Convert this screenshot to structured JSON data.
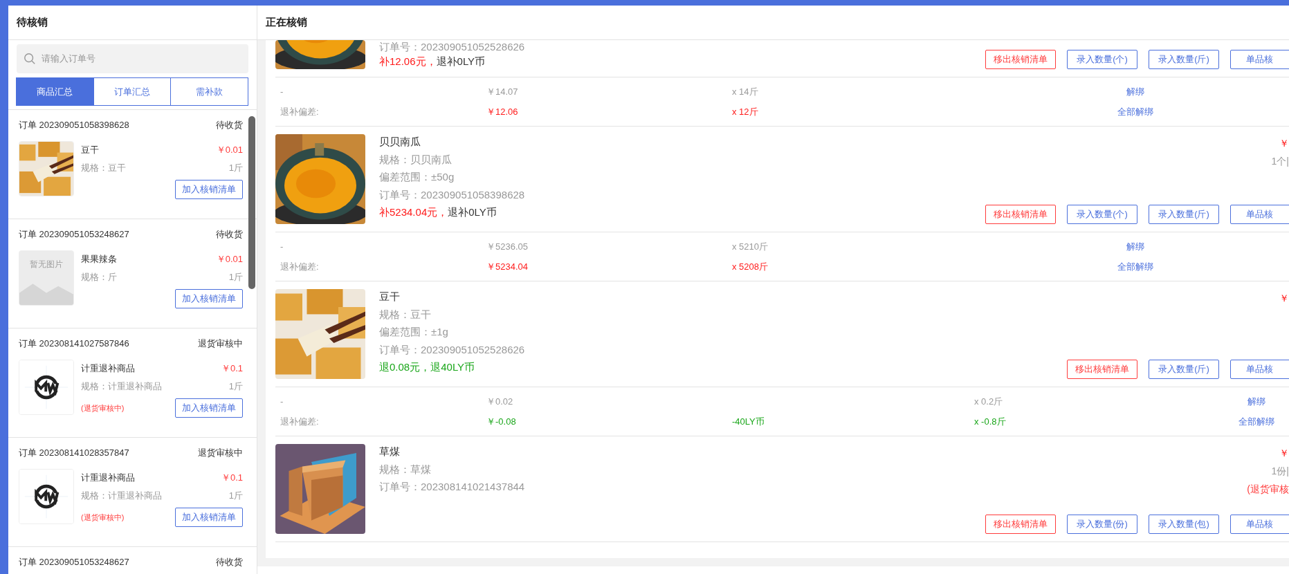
{
  "pending_panel": {
    "title": "待核销",
    "search": {
      "placeholder": "请输入订单号"
    },
    "tabs": [
      {
        "label": "商品汇总",
        "selected": true
      },
      {
        "label": "订单汇总",
        "selected": false
      },
      {
        "label": "需补款",
        "selected": false
      }
    ],
    "orders": [
      {
        "order": "订单 202309051058398628",
        "status": "待收货",
        "product": {
          "name": "豆干",
          "price": "￥0.01",
          "spec": "规格：豆干",
          "qty": "1斤",
          "button": "加入核销清单"
        }
      },
      {
        "order": "订单 202309051053248627",
        "status": "待收货",
        "product": {
          "image": {
            "kind": "placeholder",
            "text": "暂无图片"
          },
          "name": "果果辣条",
          "price": "￥0.01",
          "spec": "规格：斤",
          "qty": "1斤",
          "button": "加入核销清单"
        }
      },
      {
        "order": "订单 202308141027587846",
        "status": "退货审核中",
        "product": {
          "name": "计重退补商品",
          "price": "￥0.1",
          "spec": "规格：计重退补商品",
          "qty": "1斤",
          "note": "(退货审核中)",
          "button": "加入核销清单"
        }
      },
      {
        "order": "订单 202308141028357847",
        "status": "退货审核中",
        "product": {
          "name": "计重退补商品",
          "price": "￥0.1",
          "spec": "规格：计重退补商品",
          "qty": "1斤",
          "note": "(退货审核中)",
          "button": "加入核销清单"
        }
      },
      {
        "order": "订单 202309051053248627",
        "status": "待收货"
      }
    ]
  },
  "active_panel": {
    "title": "正在核销",
    "items": [
      {
        "cut_off_top": true,
        "lines": [
          "订单号：202309051052528626"
        ],
        "settle": [
          {
            "text": "补12.06元，",
            "color": "#ff1a1a"
          },
          {
            "text": "退补0LY币",
            "color": "#333333"
          }
        ],
        "buttons": [
          {
            "label": "移出核销清单",
            "kind": "danger"
          },
          {
            "label": "录入数量(个)",
            "kind": "primary"
          },
          {
            "label": "录入数量(斤)",
            "kind": "primary"
          },
          {
            "label": "单品核",
            "kind": "primary"
          }
        ],
        "summary": [
          {
            "label": "-",
            "price": "￥14.07",
            "qty": "x 14斤",
            "action": "解绑",
            "color": "#999999"
          },
          {
            "label": "退补偏差:",
            "price": "￥12.06",
            "qty": "x 12斤",
            "action": "全部解绑",
            "color": "#ff1a1a"
          }
        ]
      },
      {
        "cut_off_top": false,
        "name": "贝贝南瓜",
        "lines": [
          "规格：贝贝南瓜",
          "偏差范围：±50g",
          "订单号：202309051058398628"
        ],
        "settle": [
          {
            "text": "补5234.04元，",
            "color": "#ff1a1a"
          },
          {
            "text": "退补0LY币",
            "color": "#333333"
          }
        ],
        "side": [
          {
            "text": "￥",
            "color": "#ff1a1a"
          },
          {
            "text": "1个|",
            "color": "#999999"
          }
        ],
        "buttons": [
          {
            "label": "移出核销清单",
            "kind": "danger"
          },
          {
            "label": "录入数量(个)",
            "kind": "primary"
          },
          {
            "label": "录入数量(斤)",
            "kind": "primary"
          },
          {
            "label": "单品核",
            "kind": "primary"
          }
        ],
        "summary": [
          {
            "label": "-",
            "price": "￥5236.05",
            "qty": "x 5210斤",
            "action": "解绑",
            "color": "#999999"
          },
          {
            "label": "退补偏差:",
            "price": "￥5234.04",
            "qty": "x 5208斤",
            "action": "全部解绑",
            "color": "#ff1a1a"
          }
        ]
      },
      {
        "cut_off_top": false,
        "name": "豆干",
        "lines": [
          "规格：豆干",
          "偏差范围：±1g",
          "订单号：202309051052528626"
        ],
        "settle": [
          {
            "text": "退0.08元，退40LY币",
            "color": "#19a619"
          }
        ],
        "side": [
          {
            "text": "￥",
            "color": "#ff1a1a"
          }
        ],
        "buttons": [
          {
            "label": "移出核销清单",
            "kind": "danger"
          },
          {
            "label": "录入数量(斤)",
            "kind": "primary"
          },
          {
            "label": "单品核",
            "kind": "primary"
          }
        ],
        "summary": [
          {
            "label": "-",
            "price": "￥0.02",
            "qty": "x 0.2斤",
            "action": "解绑",
            "color": "#999999"
          },
          {
            "label": "退补偏差:",
            "price": "￥-0.08",
            "coins": "-40LY币",
            "qty": "x -0.8斤",
            "action": "全部解绑",
            "color": "#19a619"
          }
        ]
      },
      {
        "cut_off_top": false,
        "name": "草煤",
        "lines": [
          "规格：草煤",
          "订单号：202308141021437844"
        ],
        "side": [
          {
            "text": "￥",
            "color": "#ff1a1a"
          },
          {
            "text": "1份|",
            "color": "#999999"
          },
          {
            "text": "(退货审核",
            "color": "#ff3b3b"
          }
        ],
        "buttons": [
          {
            "label": "移出核销清单",
            "kind": "danger"
          },
          {
            "label": "录入数量(份)",
            "kind": "primary"
          },
          {
            "label": "录入数量(包)",
            "kind": "primary"
          },
          {
            "label": "单品核",
            "kind": "primary"
          }
        ]
      }
    ]
  }
}
